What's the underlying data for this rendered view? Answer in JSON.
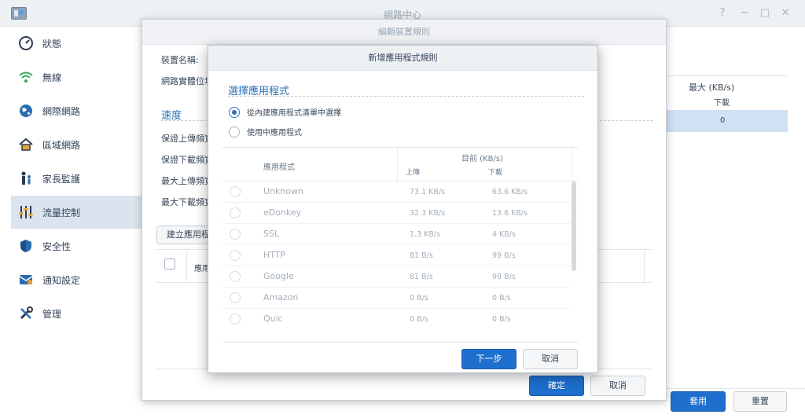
{
  "window": {
    "title": "網路中心",
    "controls": [
      "?",
      "−",
      "□",
      "✕"
    ]
  },
  "sidebar": {
    "items": [
      {
        "label": "狀態",
        "icon": "gauge-icon"
      },
      {
        "label": "無線",
        "icon": "wifi-icon"
      },
      {
        "label": "網際網路",
        "icon": "globe-icon"
      },
      {
        "label": "區域網路",
        "icon": "home-icon"
      },
      {
        "label": "家長監護",
        "icon": "family-icon"
      },
      {
        "label": "流量控制",
        "icon": "sliders-icon",
        "active": true
      },
      {
        "label": "安全性",
        "icon": "shield-icon"
      },
      {
        "label": "通知設定",
        "icon": "notification-icon"
      },
      {
        "label": "管理",
        "icon": "tools-icon"
      }
    ]
  },
  "background_table": {
    "header_max": "最大 (KB/s)",
    "header_download": "下載",
    "row_value": "0"
  },
  "main_footer": {
    "apply": "套用",
    "reset": "重置"
  },
  "edit_dialog": {
    "title": "編輯裝置規則",
    "device_name_label": "裝置名稱:",
    "mac_label": "網路實體位址",
    "speed_section": "速度",
    "guaranteed_upload": "保證上傳頻寬",
    "guaranteed_download": "保證下載頻寬",
    "max_upload": "最大上傳頻寬",
    "max_download": "最大下載頻寬",
    "create_rule_button": "建立應用程式",
    "app_column": "應用",
    "ok": "確定",
    "cancel": "取消"
  },
  "add_dialog": {
    "title": "新增應用程式規則",
    "heading": "選擇應用程式",
    "option_builtin": "從內建應用程式清單中選擇",
    "option_in_use": "使用中應用程式",
    "col_app": "應用程式",
    "col_current": "目前 (KB/s)",
    "col_upload": "上傳",
    "col_download": "下載",
    "apps": [
      {
        "name": "Unknown",
        "up": "73.1 KB/s",
        "down": "63.6 KB/s"
      },
      {
        "name": "eDonkey",
        "up": "32.3 KB/s",
        "down": "13.6 KB/s"
      },
      {
        "name": "SSL",
        "up": "1.3 KB/s",
        "down": "4 KB/s"
      },
      {
        "name": "HTTP",
        "up": "81 B/s",
        "down": "99 B/s"
      },
      {
        "name": "Google",
        "up": "81 B/s",
        "down": "99 B/s"
      },
      {
        "name": "Amazon",
        "up": "0 B/s",
        "down": "0 B/s"
      },
      {
        "name": "Quic",
        "up": "0 B/s",
        "down": "0 B/s"
      }
    ],
    "next": "下一步",
    "cancel": "取消"
  }
}
